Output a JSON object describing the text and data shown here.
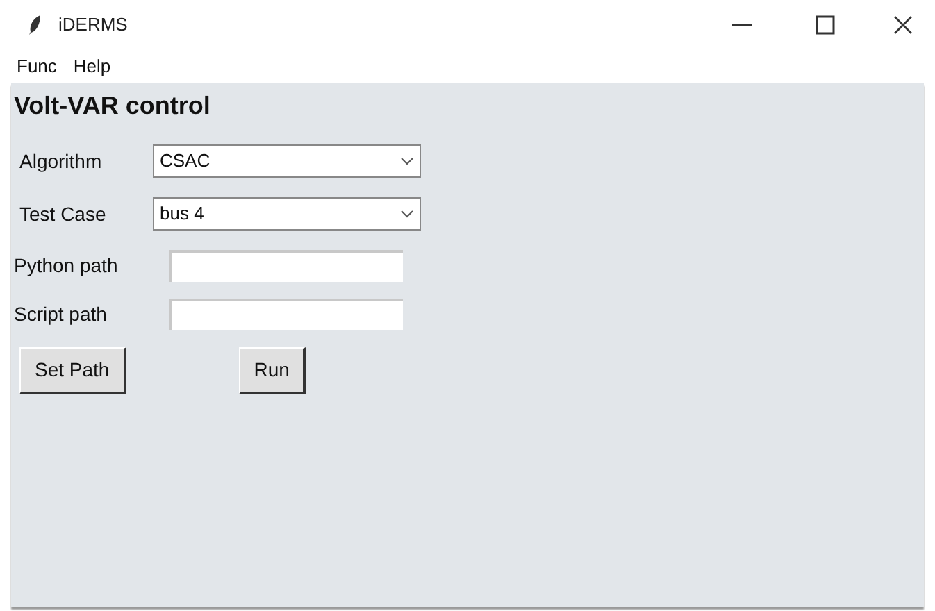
{
  "window": {
    "title": "iDERMS"
  },
  "menu": [
    "Func",
    "Help"
  ],
  "heading": "Volt-VAR control",
  "combos": [
    {
      "label": "Algorithm",
      "value": "CSAC"
    },
    {
      "label": "Test Case",
      "value": "bus 4"
    }
  ],
  "fields": [
    {
      "label": "Python path"
    },
    {
      "label": "Script path"
    }
  ],
  "buttons": [
    "Set Path",
    "Run"
  ]
}
